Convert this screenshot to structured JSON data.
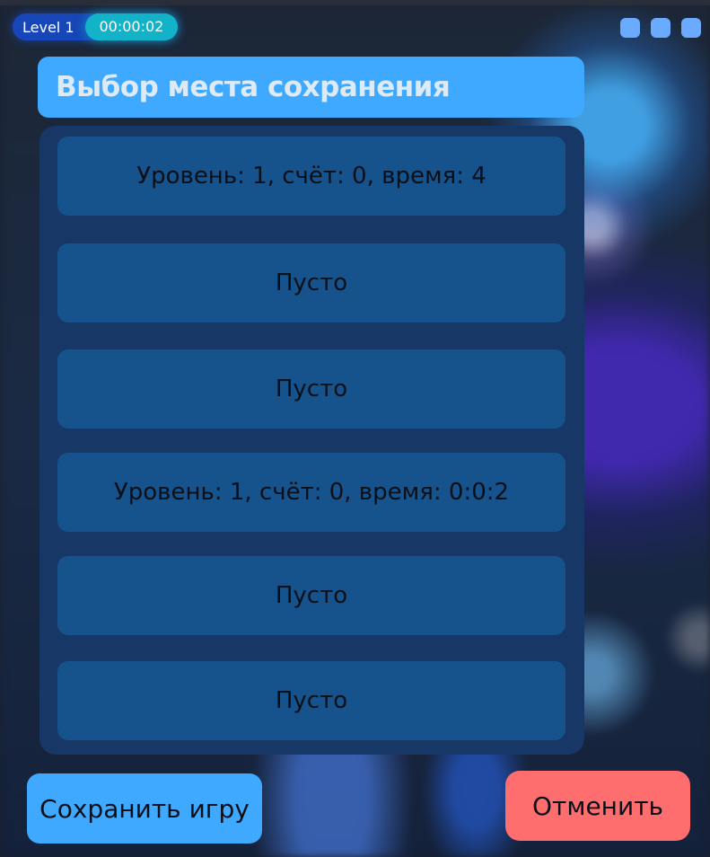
{
  "hud": {
    "level_label": "Level 1",
    "timer": "00:00:02"
  },
  "dialog": {
    "title": "Выбор места сохранения",
    "slots": [
      "Уровень: 1, счёт: 0, время: 4",
      "Пусто",
      "Пусто",
      "Уровень: 1, счёт: 0, время: 0:0:2",
      "Пусто",
      "Пусто"
    ],
    "save_label": "Сохранить игру",
    "cancel_label": "Отменить"
  },
  "colors": {
    "header": "#3ea9ff",
    "panel": "#173766",
    "slot": "#16538c",
    "save_button": "#3ea9ff",
    "cancel_button": "#ff6e6e",
    "timer": "#12b3c8"
  }
}
